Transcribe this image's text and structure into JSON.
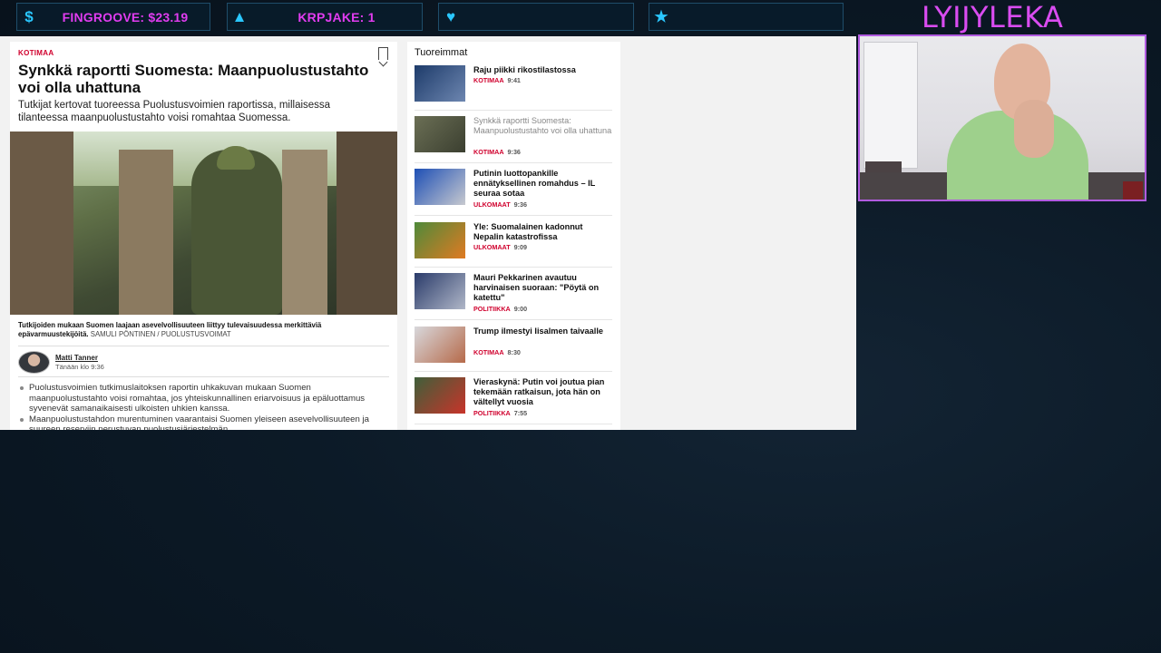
{
  "overlay": {
    "stats": [
      {
        "icon": "dollar-icon",
        "glyph": "$",
        "text": "FINGROOVE: $23.19"
      },
      {
        "icon": "drop-icon",
        "glyph": "▲",
        "text": "KRPJAKE: 1"
      },
      {
        "icon": "heart-icon",
        "glyph": "♥",
        "text": ""
      },
      {
        "icon": "star-icon",
        "glyph": "★",
        "text": ""
      }
    ],
    "brand": "LYIJYLEKA",
    "accent_color": "#e13cf0",
    "icon_color": "#2ac7ff"
  },
  "article": {
    "category": "KOTIMAA",
    "headline": "Synkkä raportti Suomesta: Maanpuolustustahto voi olla uhattuna",
    "lead": "Tutkijat kertovat tuoreessa Puolustusvoimien raportissa, millaisessa tilanteessa maanpuolustustahto voisi romahtaa Suomessa.",
    "caption": "Tutkijoiden mukaan Suomen laajaan asevelvollisuuteen liittyy tulevaisuudessa merkittäviä epävarmuustekijöitä.",
    "credit": "SAMULI PÖNTINEN / PUOLUSTUSVOIMAT",
    "author": "Matti Tanner",
    "time": "Tänään klo 9:36",
    "bullets": [
      "Puolustusvoimien tutkimuslaitoksen raportin uhkakuvan mukaan Suomen maanpuolustustahto voisi romahtaa, jos yhteiskunnallinen eriarvoisuus ja epäluottamus syvenevät samanaikaisesti ulkoisten uhkien kanssa.",
      "Maanpuolustustahdon murentuminen vaarantaisi Suomen yleiseen asevelvollisuuteen ja suureen reserviin perustuvan puolustusjärjestelmän."
    ]
  },
  "sidebar": {
    "title": "Tuoreimmat",
    "items": [
      {
        "title": "Raju piikki rikostilastossa",
        "category": "KOTIMAA",
        "time": "9:41"
      },
      {
        "title": "Synkkä raportti Suomesta: Maanpuolustustahto voi olla uhattuna",
        "category": "KOTIMAA",
        "time": "9:36"
      },
      {
        "title": "Putinin luottopankille ennätyksellinen romahdus – IL seuraa sotaa",
        "category": "ULKOMAAT",
        "time": "9:36"
      },
      {
        "title": "Yle: Suomalainen kadonnut Nepalin katastrofissa",
        "category": "ULKOMAAT",
        "time": "9:09"
      },
      {
        "title": "Mauri Pekkarinen avautuu harvinaisen suoraan: \"Pöytä on katettu\"",
        "category": "POLITIIKKA",
        "time": "9:00"
      },
      {
        "title": "Trump ilmestyi Iisalmen taivaalle",
        "category": "KOTIMAA",
        "time": "8:30"
      },
      {
        "title": "Vieraskynä: Putin voi joutua pian tekemään ratkaisun, jota hän on vältellyt vuosia",
        "category": "POLITIIKKA",
        "time": "7:55"
      }
    ]
  }
}
